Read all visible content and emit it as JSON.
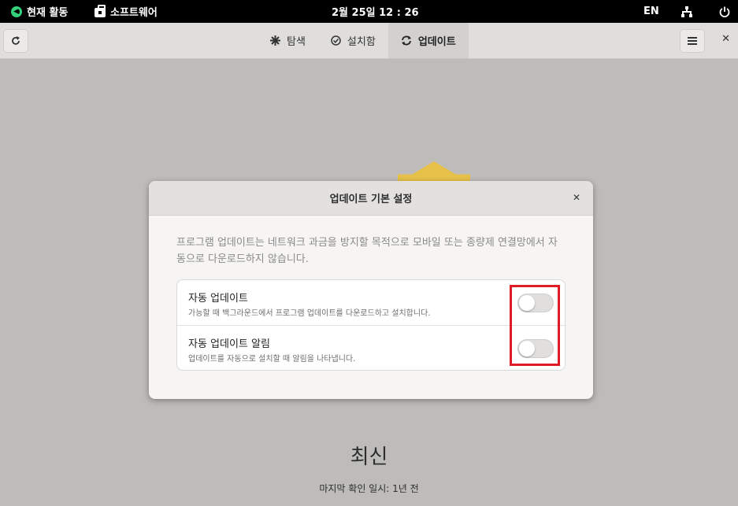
{
  "topbar": {
    "activities": "현재 활동",
    "app": "소프트웨어",
    "clock": "2월 25일 12 : 26",
    "lang": "EN"
  },
  "header": {
    "tabs": [
      {
        "label": "탐색",
        "icon": "explore-icon"
      },
      {
        "label": "설치함",
        "icon": "installed-icon"
      },
      {
        "label": "업데이트",
        "icon": "updates-icon"
      }
    ],
    "refresh_icon": "refresh-icon",
    "menu_icon": "menu-icon",
    "close_icon": "close-icon"
  },
  "main": {
    "status_title": "최신",
    "status_sub": "마지막 확인 일시: 1년 전"
  },
  "dialog": {
    "title": "업데이트 기본 설정",
    "description": "프로그램 업데이트는 네트워크 과금을 방지할 목적으로 모바일 또는 종량제 연결망에서 자동으로 다운로드하지 않습니다.",
    "rows": [
      {
        "title": "자동 업데이트",
        "subtitle": "가능할 때 백그라운드에서 프로그램 업데이트를 다운로드하고 설치합니다.",
        "enabled": false
      },
      {
        "title": "자동 업데이트 알림",
        "subtitle": "업데이트를 자동으로 설치할 때 알림을 나타냅니다.",
        "enabled": false
      }
    ]
  },
  "colors": {
    "highlight": "#e01b24",
    "sun": "#e7c14a"
  }
}
